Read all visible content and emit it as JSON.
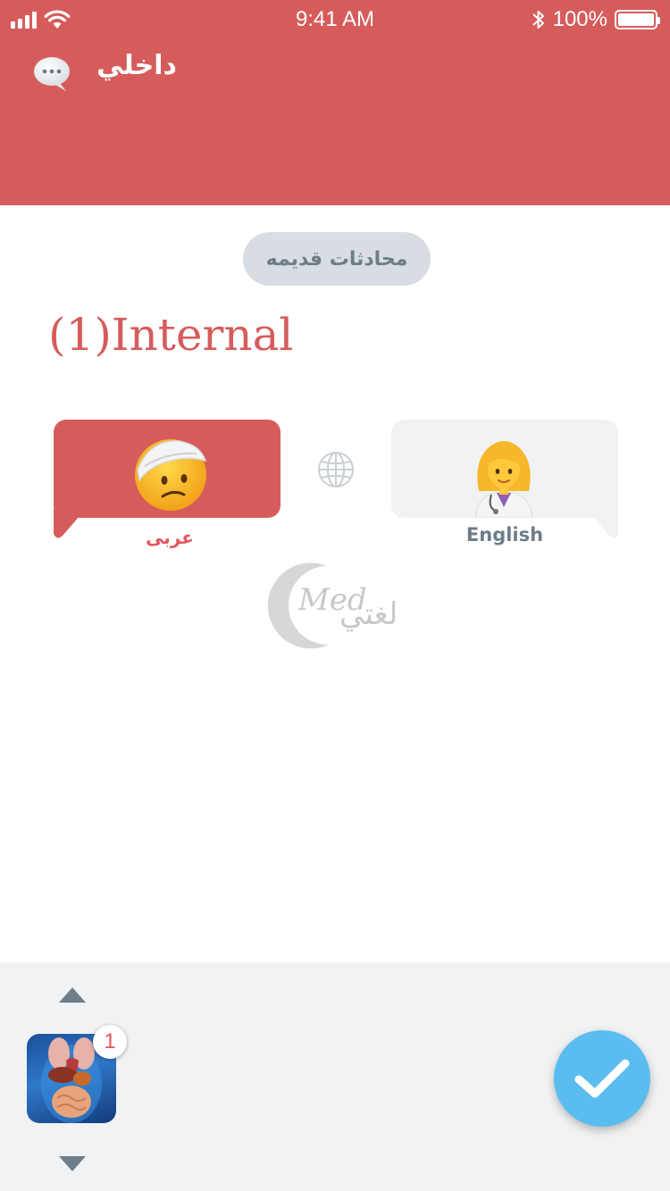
{
  "status_bar": {
    "time": "9:41 AM",
    "battery_text": "100%",
    "battery_level": 1.0,
    "signal_bars": 4,
    "icons": [
      "signal-icon",
      "wifi-icon",
      "bluetooth-icon",
      "battery-icon"
    ]
  },
  "header": {
    "title": "داخلي",
    "chat_icon": "speech-bubble-icon",
    "background_color": "#d65c5c"
  },
  "old_conversations_button": {
    "label": "محادثات قديمه"
  },
  "conversation": {
    "title": "(1)Internal"
  },
  "languages": {
    "patient": {
      "label": "عربى",
      "emoji": "head-bandage-emoji",
      "color": "#d65c5c"
    },
    "doctor": {
      "label": "English",
      "emoji": "woman-health-worker-emoji",
      "color": "#f1f2f4"
    },
    "switch_icon": "globe-icon"
  },
  "logo": {
    "latin": "Med",
    "arabic": "لغتي"
  },
  "bottom_bar": {
    "arrow_up_icon": "triangle-up-icon",
    "arrow_down_icon": "triangle-down-icon",
    "thumbnail": "anatomy-organs-thumbnail",
    "badge_count": "1",
    "confirm_icon": "checkmark-icon",
    "confirm_color": "#5bbdef"
  }
}
